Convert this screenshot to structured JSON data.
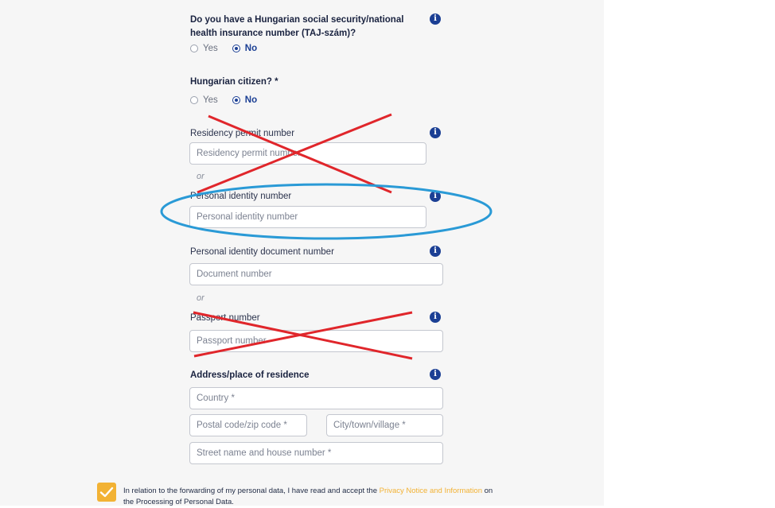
{
  "taj": {
    "question_line1": "Do you have a Hungarian social security/national",
    "question_line2": "health insurance number (TAJ-szám)?",
    "yes_label": "Yes",
    "no_label": "No",
    "selected": "No"
  },
  "citizen": {
    "question": "Hungarian citizen? *",
    "yes_label": "Yes",
    "no_label": "No",
    "selected": "No"
  },
  "residency": {
    "label": "Residency permit number",
    "placeholder": "Residency permit number"
  },
  "or_1": "or",
  "personal_id": {
    "label": "Personal identity number",
    "placeholder": "Personal identity number"
  },
  "id_document": {
    "label": "Personal identity document number",
    "placeholder": "Document number"
  },
  "or_2": "or",
  "passport": {
    "label": "Passport number",
    "placeholder": "Passport number"
  },
  "address": {
    "heading": "Address/place of residence",
    "country_placeholder": "Country *",
    "postal_placeholder": "Postal code/zip code *",
    "city_placeholder": "City/town/village *",
    "street_placeholder": "Street name and house number *"
  },
  "consent": {
    "checked": true,
    "text_before": "In relation to the forwarding of my personal data, I have read and accept the ",
    "link_text": "Privacy Notice and Information",
    "text_after": " on",
    "line2": "the Processing of Personal Data."
  },
  "icons": {
    "info": "info-icon",
    "check": "checkmark-icon"
  },
  "colors": {
    "accent": "#1b3f94",
    "checkbox": "#f2b234",
    "strike": "#e0262b",
    "highlight": "#2a9ad6"
  }
}
